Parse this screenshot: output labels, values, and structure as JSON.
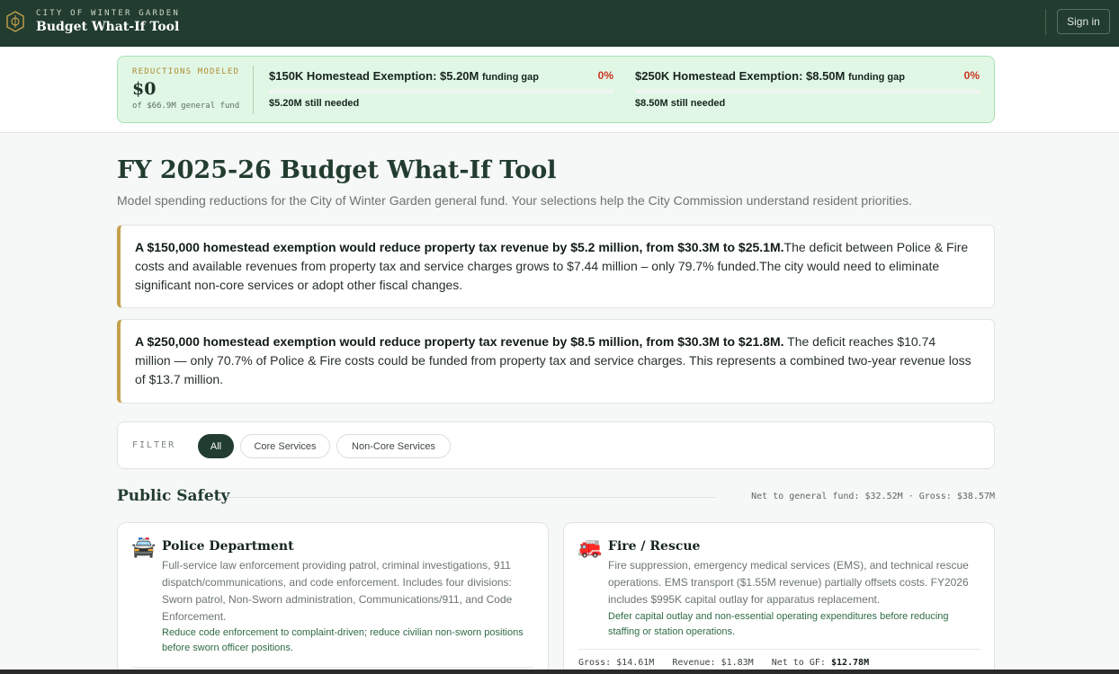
{
  "header": {
    "city": "CITY OF WINTER GARDEN",
    "title": "Budget What-If Tool",
    "signin_label": "Sign in"
  },
  "summary": {
    "reductions_label": "REDUCTIONS MODELED",
    "reductions_value": "$0",
    "reductions_sub": "of $66.9M general fund",
    "gaps": [
      {
        "label": "$150K Homestead Exemption: $5.20M",
        "suffix": "funding gap",
        "percent": "0%",
        "progress": 0,
        "needed": "$5.20M still needed"
      },
      {
        "label": "$250K Homestead Exemption: $8.50M",
        "suffix": "funding gap",
        "percent": "0%",
        "progress": 0,
        "needed": "$8.50M still needed"
      }
    ]
  },
  "page": {
    "title": "FY 2025-26 Budget What-If Tool",
    "subtitle": "Model spending reductions for the City of Winter Garden general fund. Your selections help the City Commission understand resident priorities."
  },
  "callouts": [
    {
      "bold": "A $150,000 homestead exemption would reduce property tax revenue by $5.2 million, from $30.3M to $25.1M.",
      "text": "The deficit between Police & Fire costs and available revenues from property tax and service charges grows to $7.44 million – only 79.7% funded.The city would need to eliminate significant non-core services or adopt other fiscal changes."
    },
    {
      "bold": "A $250,000 homestead exemption would reduce property tax revenue by $8.5 million, from $30.3M to $21.8M.",
      "text": " The deficit reaches $10.74 million — only 70.7% of Police & Fire costs could be funded from property tax and service charges. This represents a combined two-year revenue loss of $13.7 million."
    }
  ],
  "filter": {
    "label": "FILTER",
    "options": [
      "All",
      "Core Services",
      "Non-Core Services"
    ],
    "selected": "All"
  },
  "section": {
    "title": "Public Safety",
    "meta": "Net to general fund: $32.52M · Gross: $38.57M"
  },
  "departments": [
    {
      "emoji": "🚔",
      "icon": "police-car-icon",
      "name": "Police Department",
      "description": "Full-service law enforcement providing patrol, criminal investigations, 911 dispatch/communications, and code enforcement. Includes four divisions: Sworn patrol, Non-Sworn administration, Communications/911, and Code Enforcement.",
      "guidance": "Reduce code enforcement to complaint-driven; reduce civilian non-sworn positions before sworn officer positions."
    },
    {
      "emoji": "🚒",
      "icon": "fire-engine-icon",
      "name": "Fire / Rescue",
      "description": "Fire suppression, emergency medical services (EMS), and technical rescue operations. EMS transport ($1.55M revenue) partially offsets costs. FY2026 includes $995K capital outlay for apparatus replacement.",
      "guidance": "Defer capital outlay and non-essential operating expenditures before reducing staffing or station operations.",
      "stats": {
        "gross_label": "Gross:",
        "gross": "$14.61M",
        "revenue_label": "Revenue:",
        "revenue": "$1.83M",
        "net_label": "Net to GF:",
        "net": "$12.78M"
      }
    }
  ],
  "colors": {
    "header_bg": "#223d2f",
    "accent_gold": "#c4a14d",
    "summary_bg": "#e1f7e6",
    "alert_red": "#c8361f",
    "guidance_green": "#2f6a46"
  }
}
